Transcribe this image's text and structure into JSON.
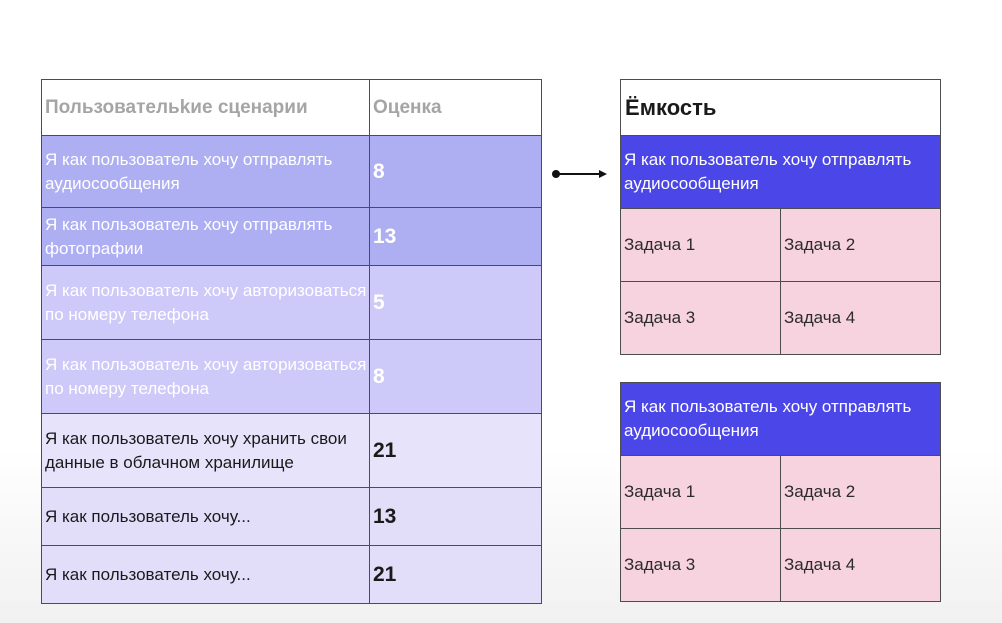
{
  "stories_table": {
    "headers": {
      "scenario": "Пользовательkие сценарии",
      "score": "Оценка"
    },
    "rows": [
      {
        "text": "Я как пользователь хочу отправлять аудиосообщения",
        "score": "8",
        "bg": "#aeaef3",
        "tone": "light"
      },
      {
        "text": "Я как пользователь хочу отправлять фотографии",
        "score": "13",
        "bg": "#aeaef3",
        "tone": "light"
      },
      {
        "text": "Я как пользователь хочу авторизоваться по номеру телефона",
        "score": "5",
        "bg": "#cdc9f8",
        "tone": "light"
      },
      {
        "text": "Я как пользователь хочу авторизоваться по номеру телефона",
        "score": "8",
        "bg": "#cdc9f8",
        "tone": "light"
      },
      {
        "text": "Я как пользователь хочу хранить свои данные в облачном хранилище",
        "score": "21",
        "bg": "#e7e3fb",
        "tone": "dark"
      },
      {
        "text": "Я как пользователь хочу...",
        "score": "13",
        "bg": "#e2defa",
        "tone": "dark"
      },
      {
        "text": "Я как пользователь хочу...",
        "score": "21",
        "bg": "#e2defa",
        "tone": "dark"
      }
    ]
  },
  "capacity_top": {
    "title": "Ёмкость",
    "story": "Я как пользователь хочу отправлять аудиосообщения",
    "tasks": [
      "Задача 1",
      "Задача 2",
      "Задача 3",
      "Задача 4"
    ]
  },
  "capacity_bottom": {
    "story": "Я как пользователь хочу отправлять аудиосообщения",
    "tasks": [
      "Задача 1",
      "Задача 2",
      "Задача 3",
      "Задача 4"
    ]
  }
}
